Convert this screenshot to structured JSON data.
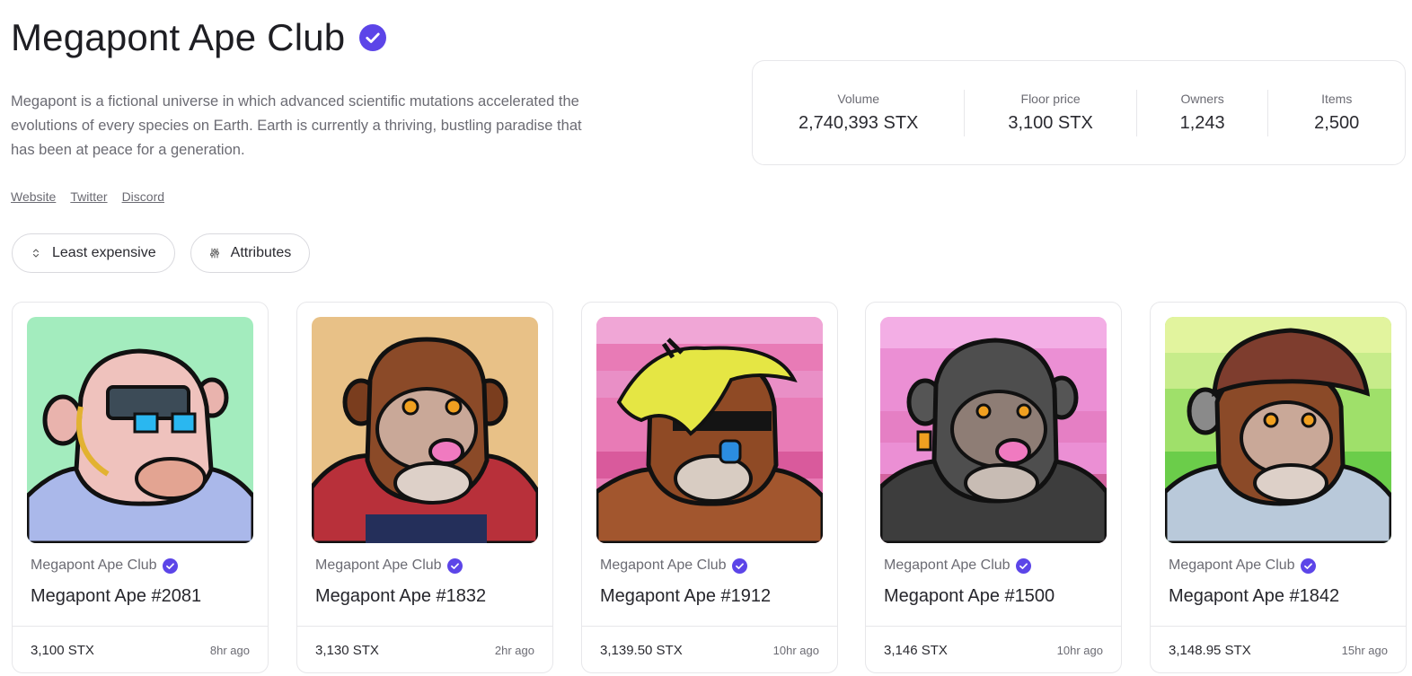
{
  "collection": {
    "title": "Megapont Ape Club",
    "verified_icon": "verified-check-icon",
    "accent_color": "#5c45e8",
    "description": "Megapont is a fictional universe in which advanced scientific mutations accelerated the evolutions of every species on Earth. Earth is currently a thriving, bustling paradise that has been at peace for a generation.",
    "links": [
      "Website",
      "Twitter",
      "Discord"
    ]
  },
  "stats": [
    {
      "label": "Volume",
      "value": "2,740,393 STX"
    },
    {
      "label": "Floor price",
      "value": "3,100 STX"
    },
    {
      "label": "Owners",
      "value": "1,243"
    },
    {
      "label": "Items",
      "value": "2,500"
    }
  ],
  "controls": {
    "sort_label": "Least expensive",
    "sort_icon": "sort-arrows-icon",
    "filter_label": "Attributes",
    "filter_icon": "sliders-icon"
  },
  "cards": [
    {
      "collection": "Megapont Ape Club",
      "name": "Megapont Ape #2081",
      "price": "3,100 STX",
      "time": "8hr ago",
      "bg": "#a3ecbe"
    },
    {
      "collection": "Megapont Ape Club",
      "name": "Megapont Ape #1832",
      "price": "3,130 STX",
      "time": "2hr ago",
      "bg": "#e8c187"
    },
    {
      "collection": "Megapont Ape Club",
      "name": "Megapont Ape #1912",
      "price": "3,139.50 STX",
      "time": "10hr ago",
      "bg": "#e87bb6"
    },
    {
      "collection": "Megapont Ape Club",
      "name": "Megapont Ape #1500",
      "price": "3,146 STX",
      "time": "10hr ago",
      "bg": "#eb8fd4"
    },
    {
      "collection": "Megapont Ape Club",
      "name": "Megapont Ape #1842",
      "price": "3,148.95 STX",
      "time": "15hr ago",
      "bg": "#9fe06a"
    }
  ]
}
